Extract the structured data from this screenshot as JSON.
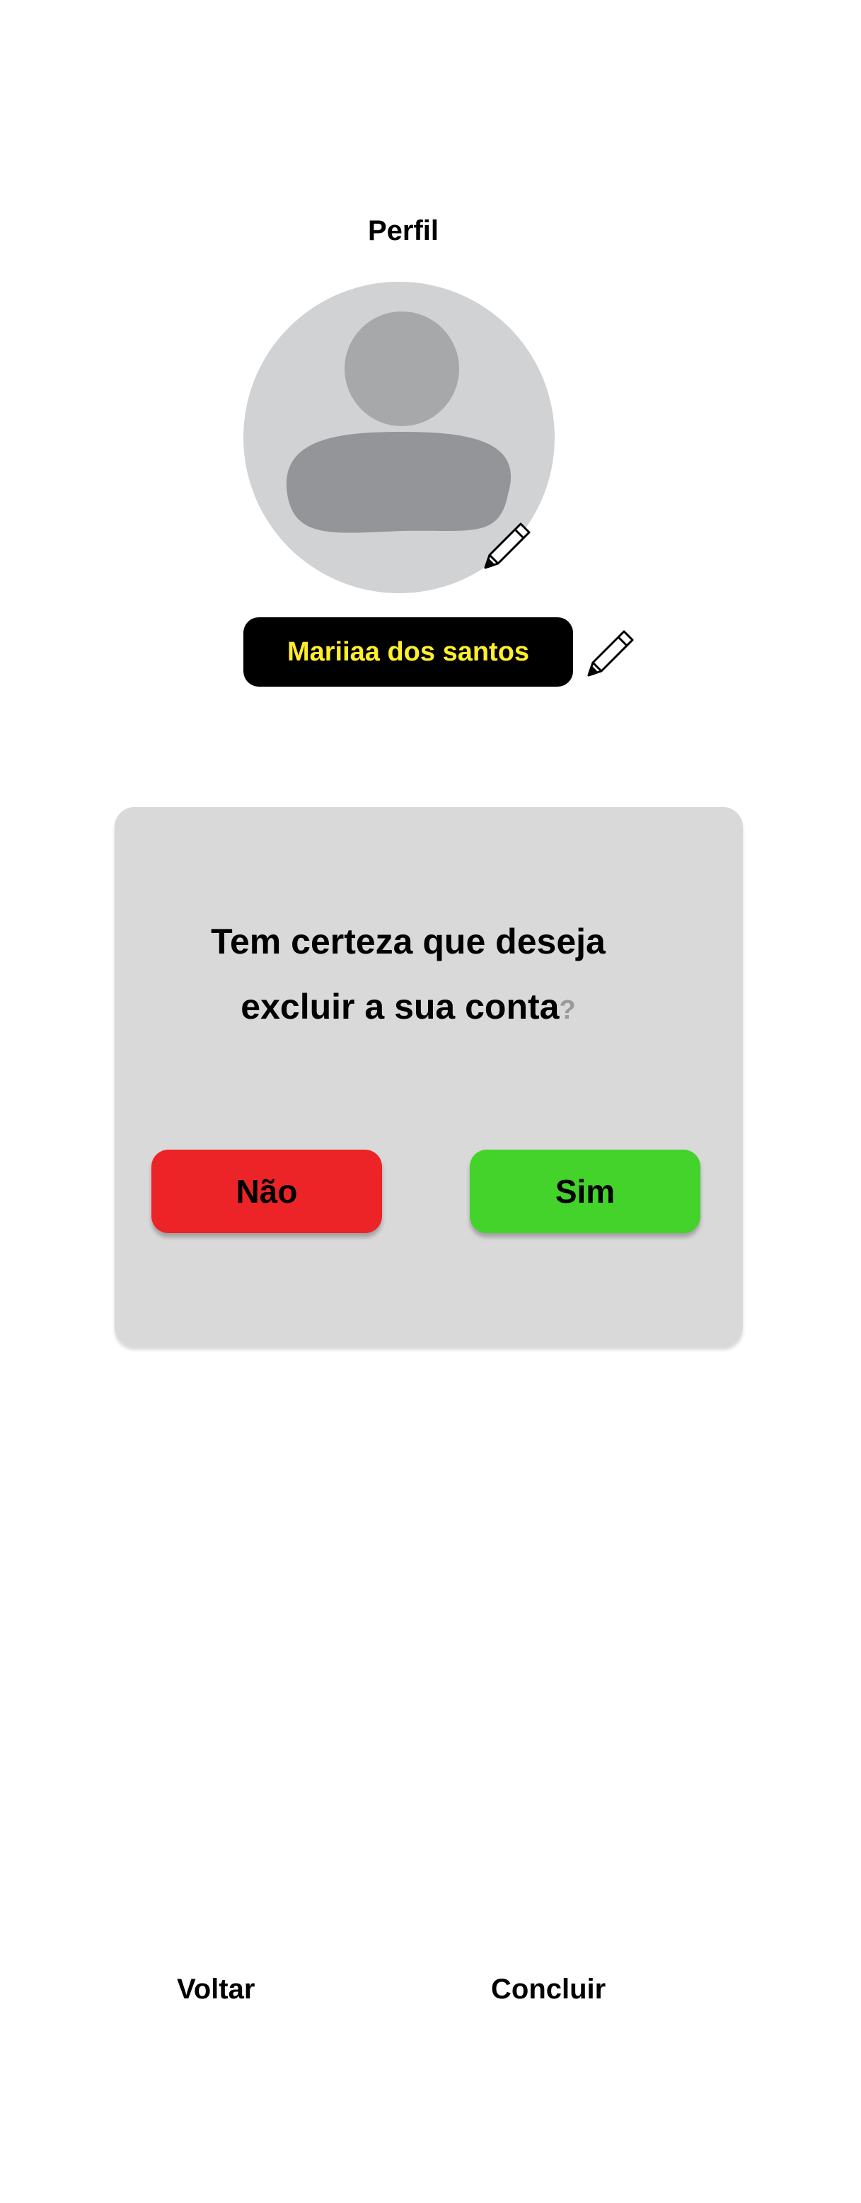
{
  "header": {
    "title": "Perfil"
  },
  "profile": {
    "name": "Mariiaa dos santos",
    "avatar_icon": "user-silhouette-icon",
    "edit_icon": "pencil-icon"
  },
  "dialog": {
    "message_line1": "Tem certeza que deseja",
    "message_line2": "excluir a sua conta",
    "question_mark": "?",
    "no_label": "Não",
    "yes_label": "Sim"
  },
  "footer": {
    "back_label": "Voltar",
    "done_label": "Concluir"
  },
  "colors": {
    "background": "#ffffff",
    "avatar_bg": "#d1d2d4",
    "avatar_head": "#a7a8aa",
    "avatar_body": "#939598",
    "name_pill_bg": "#000000",
    "name_text": "#ffee2a",
    "dialog_bg": "#d9d9d9",
    "no_button": "#ec2427",
    "yes_button": "#43d32a"
  }
}
